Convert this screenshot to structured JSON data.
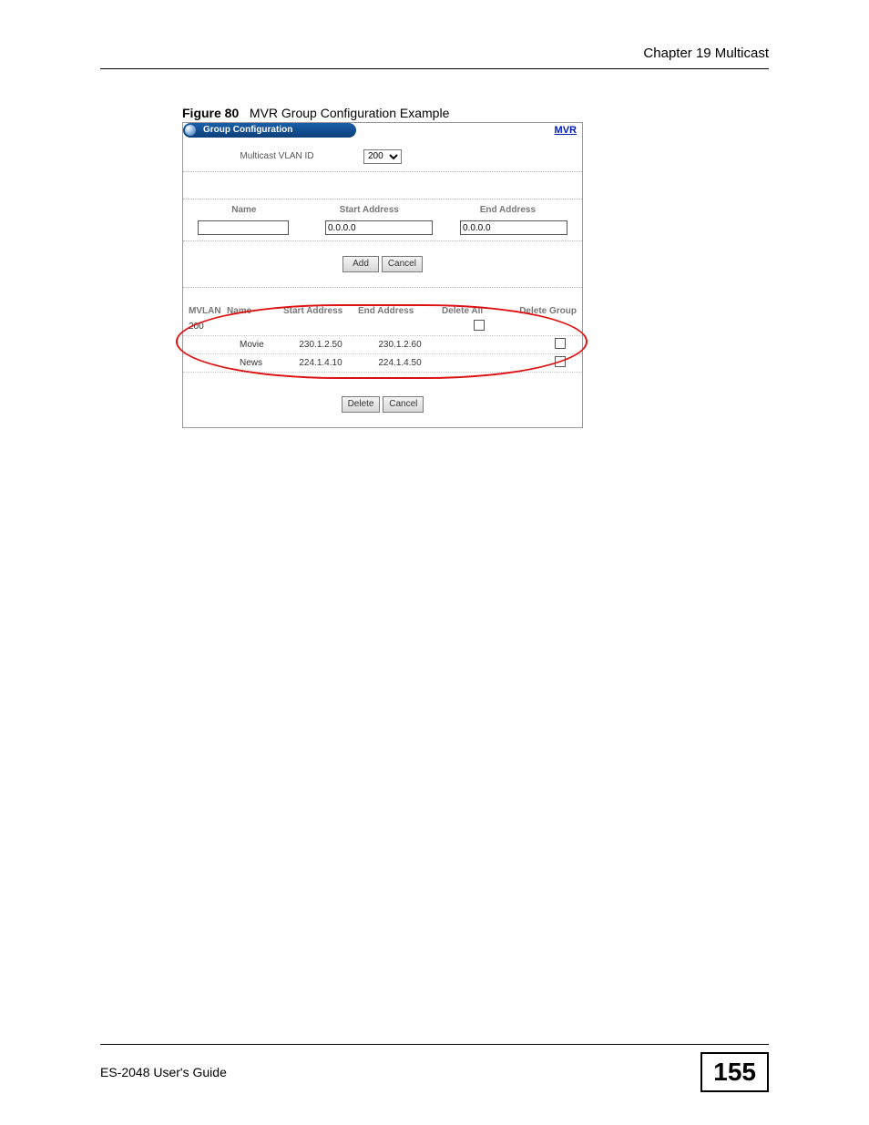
{
  "header": {
    "chapter": "Chapter 19 Multicast"
  },
  "figure": {
    "label": "Figure 80",
    "title": "MVR Group Configuration Example"
  },
  "panel": {
    "title": "Group Configuration",
    "mvr_link": "MVR",
    "vlan_label": "Multicast VLAN ID",
    "vlan_selected": "200",
    "col_name": "Name",
    "col_start": "Start Address",
    "col_end": "End Address",
    "start_value": "0.0.0.0",
    "end_value": "0.0.0.0",
    "btn_add": "Add",
    "btn_cancel": "Cancel",
    "list_head": {
      "mvlan": "MVLAN",
      "name": "Name",
      "start": "Start Address",
      "end": "End Address",
      "del_all": "Delete All",
      "del_group": "Delete Group"
    },
    "rows": [
      {
        "mvlan": "200",
        "name": "",
        "start": "",
        "end": "",
        "del_all": true,
        "del_group": false
      },
      {
        "mvlan": "",
        "name": "Movie",
        "start": "230.1.2.50",
        "end": "230.1.2.60",
        "del_all": false,
        "del_group": true
      },
      {
        "mvlan": "",
        "name": "News",
        "start": "224.1.4.10",
        "end": "224.1.4.50",
        "del_all": false,
        "del_group": true
      }
    ],
    "btn_delete": "Delete",
    "btn_cancel2": "Cancel"
  },
  "footer": {
    "guide": "ES-2048 User's Guide",
    "page": "155"
  }
}
